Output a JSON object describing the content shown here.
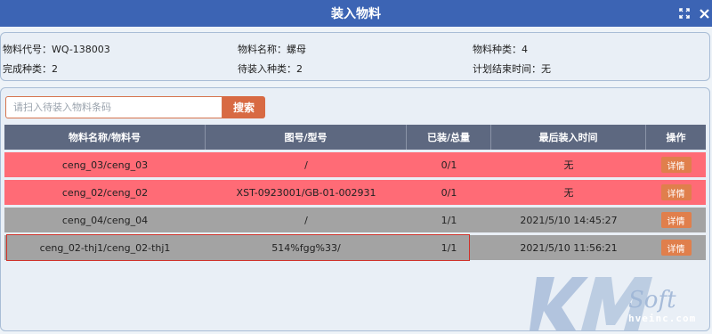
{
  "window": {
    "title": "装入物料",
    "maximize_icon": "expand-icon",
    "close_icon": "close-icon"
  },
  "info": {
    "material_code": "物料代号：WQ-138003",
    "material_name": "物料名称：螺母",
    "material_kinds": "物料种类：4",
    "done_kinds": "完成种类：2",
    "pending_kinds": "待装入种类：2",
    "plan_end_time": "计划结束时间：无"
  },
  "search": {
    "placeholder": "请扫入待装入物料条码",
    "value": "",
    "button_label": "搜索"
  },
  "table": {
    "headers": [
      "物料名称/物料号",
      "图号/型号",
      "已装/总量",
      "最后装入时间",
      "操作"
    ],
    "rows": [
      {
        "name": "ceng_03/ceng_03",
        "drawing": "/",
        "qty": "0/1",
        "time": "无",
        "action": "详情",
        "status": "red"
      },
      {
        "name": "ceng_02/ceng_02",
        "drawing": "XST-0923001/GB-01-002931",
        "qty": "0/1",
        "time": "无",
        "action": "详情",
        "status": "red"
      },
      {
        "name": "ceng_04/ceng_04",
        "drawing": "/",
        "qty": "1/1",
        "time": "2021/5/10 14:45:27",
        "action": "详情",
        "status": "gray"
      },
      {
        "name": "ceng_02-thj1/ceng_02-thj1",
        "drawing": "514%fgg%33/",
        "qty": "1/1",
        "time": "2021/5/10 11:56:21",
        "action": "详情",
        "status": "gray"
      }
    ]
  },
  "watermark": {
    "brand": "Soft",
    "site": "hveinc.com"
  }
}
